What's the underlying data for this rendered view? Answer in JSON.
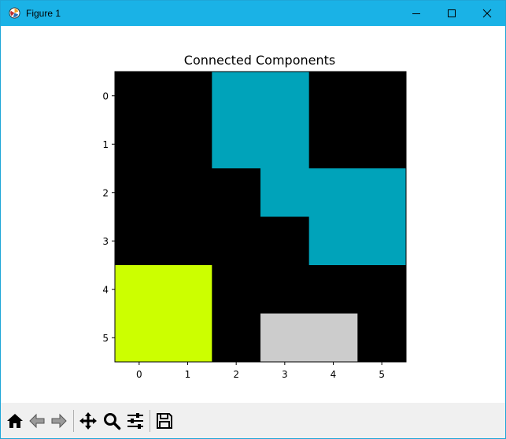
{
  "window": {
    "title": "Figure 1"
  },
  "titlebar_icons": {
    "minimize": "minimize-icon",
    "maximize": "maximize-icon",
    "close": "close-icon",
    "app": "matplotlib-app-icon"
  },
  "toolbar": {
    "items": [
      {
        "name": "home-icon",
        "enabled": true
      },
      {
        "name": "back-arrow-icon",
        "enabled": false
      },
      {
        "name": "forward-arrow-icon",
        "enabled": false
      },
      {
        "name": "pan-move-icon",
        "enabled": true
      },
      {
        "name": "zoom-magnifier-icon",
        "enabled": true
      },
      {
        "name": "configure-subplots-icon",
        "enabled": true
      },
      {
        "name": "save-figure-icon",
        "enabled": true
      }
    ]
  },
  "chart_data": {
    "type": "heatmap",
    "title": "Connected Components",
    "xlabel": "",
    "ylabel": "",
    "x_ticks": [
      "0",
      "1",
      "2",
      "3",
      "4",
      "5"
    ],
    "y_ticks": [
      "0",
      "1",
      "2",
      "3",
      "4",
      "5"
    ],
    "grid": false,
    "colors": {
      "0": "#000000",
      "1": "#00a3ba",
      "2": "#ccff00",
      "3": "#cccccc"
    },
    "matrix": [
      [
        0,
        0,
        1,
        1,
        0,
        0
      ],
      [
        0,
        0,
        1,
        1,
        0,
        0
      ],
      [
        0,
        0,
        0,
        1,
        1,
        1
      ],
      [
        0,
        0,
        0,
        0,
        1,
        1
      ],
      [
        2,
        2,
        0,
        0,
        0,
        0
      ],
      [
        2,
        2,
        0,
        3,
        3,
        0
      ]
    ]
  }
}
